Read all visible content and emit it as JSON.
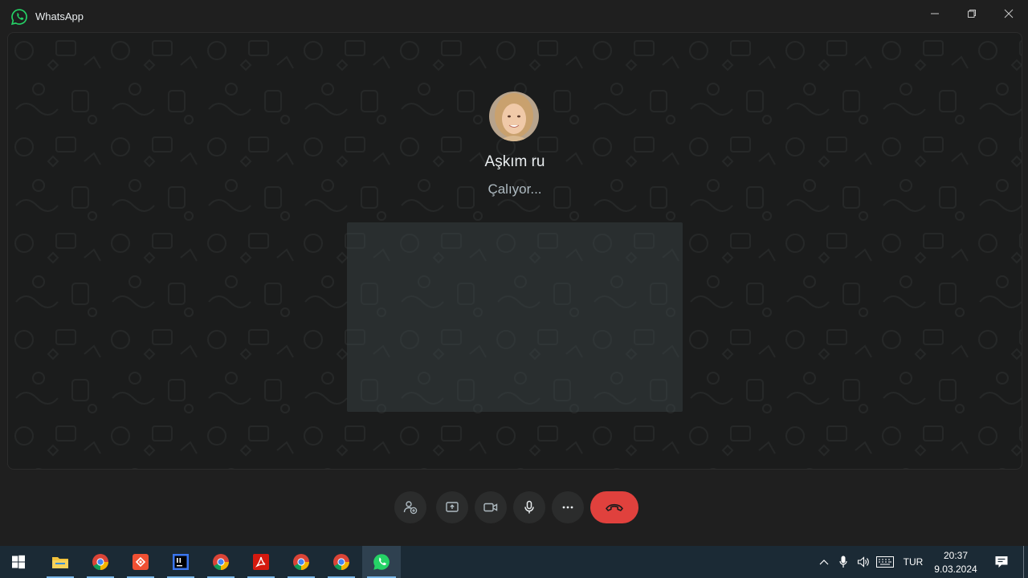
{
  "window": {
    "title": "WhatsApp",
    "controls": [
      "minimize-icon",
      "restore-icon",
      "close-icon"
    ]
  },
  "call": {
    "contact_name": "Aşkım ru",
    "status": "Çalıyor...",
    "avatar": "contact-avatar"
  },
  "controls": [
    {
      "name": "add-participant",
      "icon": "person-add-icon"
    },
    {
      "name": "share-screen",
      "icon": "screen-share-icon"
    },
    {
      "name": "video-toggle",
      "icon": "video-camera-icon"
    },
    {
      "name": "mute-toggle",
      "icon": "microphone-icon"
    },
    {
      "name": "more-options",
      "icon": "ellipsis-icon"
    },
    {
      "name": "end-call",
      "icon": "phone-hangup-icon",
      "color": "#e0413d"
    }
  ],
  "taskbar": {
    "apps": [
      "start",
      "file-explorer",
      "chrome",
      "git-app",
      "intellij",
      "chrome",
      "acrobat-reader",
      "chrome",
      "chrome",
      "whatsapp"
    ],
    "language": "TUR",
    "time": "20:37",
    "date": "9.03.2024"
  },
  "colors": {
    "background": "#1f1f1f",
    "accent": "#25d366",
    "end_call": "#e0413d",
    "taskbar": "#1b2a35"
  }
}
